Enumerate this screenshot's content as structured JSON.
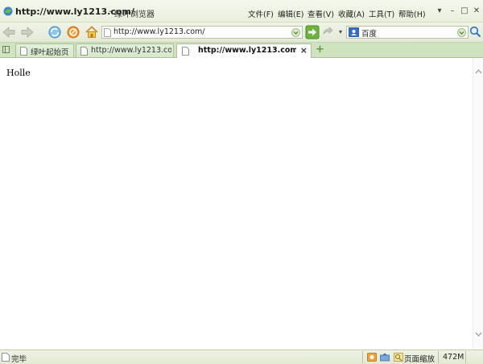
{
  "window": {
    "title_url": "http://www.ly1213.com/",
    "title_separator": "-",
    "app_name": "绿叶浏览器"
  },
  "menu": {
    "items": [
      "文件(F)",
      "编辑(E)",
      "查看(V)",
      "收藏(A)",
      "工具(T)",
      "帮助(H)"
    ]
  },
  "window_controls": {
    "dropdown": "▾",
    "minimize": "–",
    "maximize": "□",
    "close": "✕"
  },
  "toolbar": {
    "address_value": "http://www.ly1213.com/",
    "search_engine": "百度",
    "search_value": ""
  },
  "tabs": [
    {
      "label": "绿叶起始页",
      "active": false
    },
    {
      "label": "http://www.ly1213.co...",
      "active": false
    },
    {
      "label": "http://www.ly1213.com/",
      "active": true
    }
  ],
  "tab_close": "×",
  "new_tab": "+",
  "page": {
    "text": "Holle"
  },
  "status": {
    "text": "完毕",
    "zoom_label": "页面缩放",
    "memory": "472M"
  },
  "colors": {
    "chrome": "#e6edd9",
    "tabbar": "#cfe3c1",
    "accent": "#5a9a3c"
  }
}
